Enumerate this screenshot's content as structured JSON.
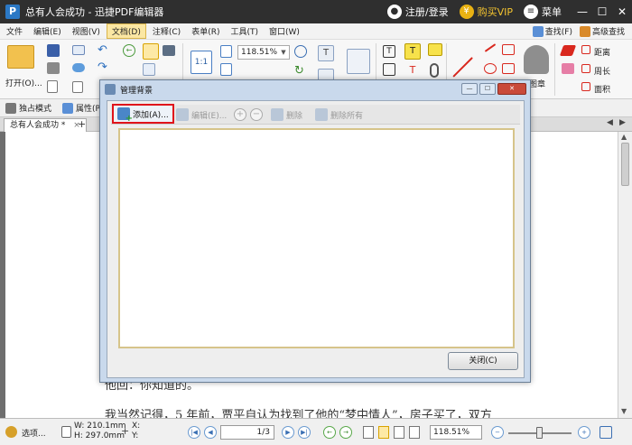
{
  "window": {
    "logo": "P",
    "title": "总有人会成功 - 迅捷PDF编辑器",
    "login": "注册/登录",
    "buy_vip": "购买VIP",
    "menu": "菜单",
    "vip_glyph": "¥",
    "minimize": "—",
    "maximize": "☐",
    "close": "✕"
  },
  "menubar": {
    "items": [
      "文件",
      "编辑(E)",
      "视图(V)",
      "文档(D)",
      "注释(C)",
      "表单(R)",
      "工具(T)",
      "窗口(W)"
    ],
    "active_index": 3,
    "right": {
      "find": "查找(F)",
      "advanced_search": "高级查找"
    }
  },
  "toolbar": {
    "open_label": "打开(O)...",
    "zoom_value": "118.51%",
    "zoom_in_label": "放大",
    "stamp_label": "图章",
    "distance_label": "距离",
    "perimeter_label": "周长",
    "area_label": "面积",
    "actual_size": "1:1"
  },
  "modebar": {
    "exclusive_mode": "独占模式",
    "properties": "属性(P)"
  },
  "doc_tab": {
    "name": "总有人会成功 *",
    "close": "×",
    "add": "+"
  },
  "page": {
    "line1": "他回：你知道的。",
    "line2": "我当然记得，5 年前，贾平自认为找到了他的“梦中情人”，房子买了，双方"
  },
  "dialog": {
    "title": "管理背景",
    "add": "添加(A)...",
    "edit": "编辑(E)...",
    "delete": "删除",
    "delete_all": "删除所有",
    "close_button": "关闭(C)",
    "plus": "+",
    "minus": "−"
  },
  "statusbar": {
    "options": "选项...",
    "width": "W: 210.1mm",
    "height": "H: 297.0mm",
    "x": "X:",
    "y": "Y:",
    "page_display": "1/3",
    "zoom": "118.51%"
  },
  "colors": {
    "titlebar": "#2f2f2f",
    "vip_gold": "#e9b213",
    "highlight_red": "#e0141b",
    "dialog_frame": "#c9d9ec"
  }
}
